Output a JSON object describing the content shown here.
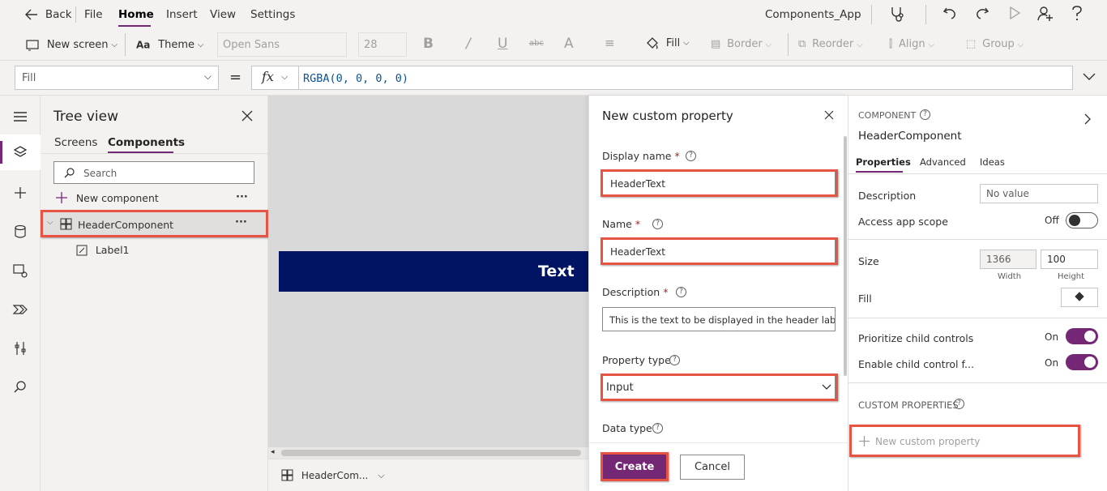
{
  "menu": {
    "back": "Back",
    "file": "File",
    "home": "Home",
    "insert": "Insert",
    "view": "View",
    "settings": "Settings",
    "app_title": "Components_App"
  },
  "toolbar": {
    "new_screen": "New screen",
    "theme": "Theme",
    "font": "Open Sans",
    "font_size": "28",
    "fill": "Fill",
    "border": "Border",
    "reorder": "Reorder",
    "align": "Align",
    "group": "Group"
  },
  "formula": {
    "property": "Fill",
    "equals": "=",
    "fx": "fx",
    "value": "RGBA(0, 0, 0, 0)"
  },
  "tree": {
    "title": "Tree view",
    "tabs": [
      "Screens",
      "Components"
    ],
    "active_tab": "Components",
    "search_placeholder": "Search",
    "new_component": "New component",
    "component": "HeaderComponent",
    "child": "Label1",
    "more": "···"
  },
  "canvas": {
    "header_text": "Text",
    "header_color": "#001463",
    "bottom_label": "HeaderCom..."
  },
  "dialog": {
    "title": "New custom property",
    "display_name_label": "Display name",
    "display_name_value": "HeaderText",
    "name_label": "Name",
    "name_value": "HeaderText",
    "description_label": "Description",
    "description_value": "This is the text to be displayed in the header label.",
    "property_type_label": "Property type",
    "property_type_value": "Input",
    "data_type_label": "Data type",
    "required_mark": "*",
    "create": "Create",
    "cancel": "Cancel",
    "accent": "#742774"
  },
  "properties": {
    "section": "COMPONENT",
    "component_name": "HeaderComponent",
    "tabs": [
      "Properties",
      "Advanced",
      "Ideas"
    ],
    "active_tab": "Properties",
    "description_label": "Description",
    "description_value": "No value",
    "access_label": "Access app scope",
    "access_state": "Off",
    "size_label": "Size",
    "width_value": "1366",
    "height_value": "100",
    "width_caption": "Width",
    "height_caption": "Height",
    "fill_label": "Fill",
    "prioritize_label": "Prioritize child controls",
    "prioritize_state": "On",
    "enable_label": "Enable child control f...",
    "enable_state": "On",
    "custom_props_header": "CUSTOM PROPERTIES",
    "new_custom_property": "New custom property"
  },
  "highlight_color": "#e85443"
}
